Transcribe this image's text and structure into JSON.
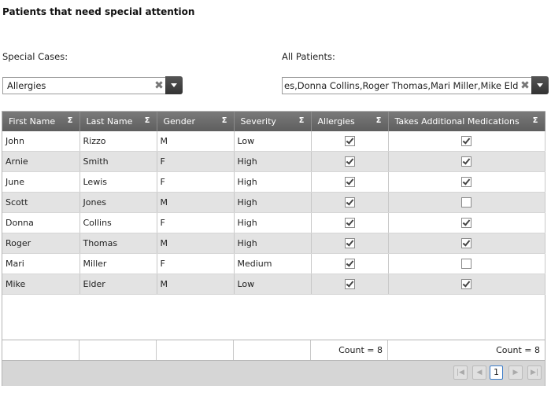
{
  "title": "Patients that need special attention",
  "special_cases": {
    "label": "Special Cases:",
    "value": "Allergies"
  },
  "all_patients": {
    "label": "All Patients:",
    "value": "es,Donna Collins,Roger Thomas,Mari Miller,Mike Elder"
  },
  "icons": {
    "clear": "close-icon",
    "dropdown": "chevron-down-icon",
    "aggregate": "sigma-icon",
    "first": "first-page-icon",
    "prev": "previous-page-icon",
    "next": "next-page-icon",
    "last": "last-page-icon"
  },
  "grid": {
    "columns": [
      "First Name",
      "Last Name",
      "Gender",
      "Severity",
      "Allergies",
      "Takes Additional Medications"
    ],
    "sigma": "Σ",
    "rows": [
      {
        "first": "John",
        "last": "Rizzo",
        "gender": "M",
        "severity": "Low",
        "allergies": true,
        "meds": true
      },
      {
        "first": "Arnie",
        "last": "Smith",
        "gender": "F",
        "severity": "High",
        "allergies": true,
        "meds": true
      },
      {
        "first": "June",
        "last": "Lewis",
        "gender": "F",
        "severity": "High",
        "allergies": true,
        "meds": true
      },
      {
        "first": "Scott",
        "last": "Jones",
        "gender": "M",
        "severity": "High",
        "allergies": true,
        "meds": false
      },
      {
        "first": "Donna",
        "last": "Collins",
        "gender": "F",
        "severity": "High",
        "allergies": true,
        "meds": true
      },
      {
        "first": "Roger",
        "last": "Thomas",
        "gender": "M",
        "severity": "High",
        "allergies": true,
        "meds": true
      },
      {
        "first": "Mari",
        "last": "Miller",
        "gender": "F",
        "severity": "Medium",
        "allergies": true,
        "meds": false
      },
      {
        "first": "Mike",
        "last": "Elder",
        "gender": "M",
        "severity": "Low",
        "allergies": true,
        "meds": true
      }
    ],
    "footer": {
      "allergies_count": "Count = 8",
      "meds_count": "Count = 8"
    }
  },
  "pager": {
    "current_page": "1"
  },
  "colors": {
    "header_bg": "#6b6b6b",
    "alt_row": "#e3e3e3",
    "pager_bg": "#d6d6d6",
    "current_page_border": "#3a7bc8"
  }
}
